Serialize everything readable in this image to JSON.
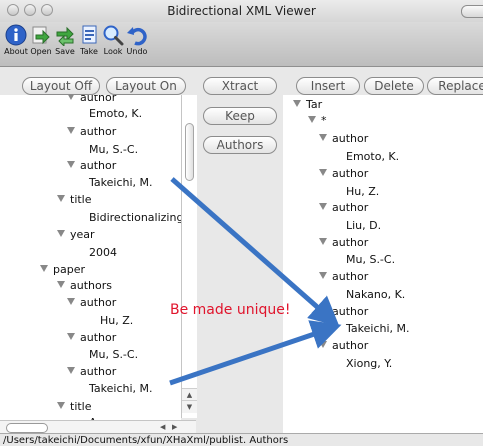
{
  "window": {
    "title": "Bidirectional XML Viewer"
  },
  "toolbar": {
    "items": [
      {
        "label": "About",
        "icon": "info-icon"
      },
      {
        "label": "Open",
        "icon": "open-arrow-icon"
      },
      {
        "label": "Save",
        "icon": "save-arrows-icon"
      },
      {
        "label": "Take",
        "icon": "take-document-icon"
      },
      {
        "label": "Look",
        "icon": "magnifier-icon"
      },
      {
        "label": "Undo",
        "icon": "undo-icon"
      }
    ]
  },
  "buttons": {
    "layout_off": "Layout Off",
    "layout_on": "Layout On",
    "xtract": "Xtract",
    "keep": "Keep",
    "authors": "Authors",
    "insert": "Insert",
    "delete": "Delete",
    "replace": "Replace"
  },
  "left_tree": [
    {
      "text": "author",
      "expanded": true
    },
    {
      "text": "Emoto, K.",
      "expanded": false
    },
    {
      "text": "author",
      "expanded": true
    },
    {
      "text": "Mu, S.-C.",
      "expanded": false
    },
    {
      "text": "author",
      "expanded": true
    },
    {
      "text": "Takeichi, M.",
      "expanded": false
    },
    {
      "text": "title",
      "expanded": true
    },
    {
      "text": "Bidirectionalizing",
      "expanded": false
    },
    {
      "text": "year",
      "expanded": true
    },
    {
      "text": "2004",
      "expanded": false
    },
    {
      "text": "paper",
      "expanded": true
    },
    {
      "text": "authors",
      "expanded": true
    },
    {
      "text": "author",
      "expanded": true
    },
    {
      "text": "Hu, Z.",
      "expanded": false
    },
    {
      "text": "author",
      "expanded": true
    },
    {
      "text": "Mu, S.-C.",
      "expanded": false
    },
    {
      "text": "author",
      "expanded": true
    },
    {
      "text": "Takeichi, M.",
      "expanded": false
    },
    {
      "text": "title",
      "expanded": true
    },
    {
      "text": "A",
      "expanded": false
    }
  ],
  "right_tree": [
    {
      "text": "Tar",
      "expanded": true
    },
    {
      "text": "*",
      "expanded": true
    },
    {
      "text": "author",
      "expanded": true
    },
    {
      "text": "Emoto, K.",
      "expanded": false
    },
    {
      "text": "author",
      "expanded": true
    },
    {
      "text": "Hu, Z.",
      "expanded": false
    },
    {
      "text": "author",
      "expanded": true
    },
    {
      "text": "Liu, D.",
      "expanded": false
    },
    {
      "text": "author",
      "expanded": true
    },
    {
      "text": "Mu, S.-C.",
      "expanded": false
    },
    {
      "text": "author",
      "expanded": true
    },
    {
      "text": "Nakano, K.",
      "expanded": false
    },
    {
      "text": "author",
      "expanded": true
    },
    {
      "text": "Takeichi, M.",
      "expanded": false
    },
    {
      "text": "author",
      "expanded": true
    },
    {
      "text": "Xiong, Y.",
      "expanded": false
    }
  ],
  "annotation": {
    "text": "Be made unique!",
    "color": "#e0142c",
    "arrow_color": "#3a74c4"
  },
  "status": {
    "path": "/Users/takeichi/Documents/xfun/XHaXml/publist.  Authors"
  }
}
